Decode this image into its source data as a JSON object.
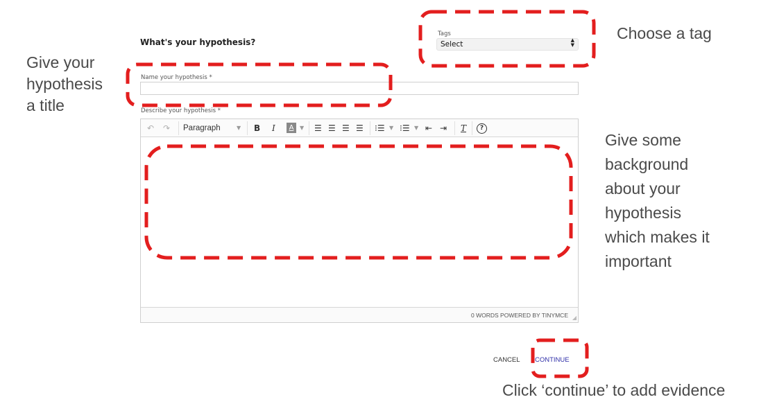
{
  "form": {
    "title": "What's your hypothesis?",
    "tags_label": "Tags",
    "tags_value": "Select",
    "name_label": "Name your hypothesis *",
    "name_value": "",
    "describe_label": "Describe your hypothesis *"
  },
  "editor": {
    "toolbar": {
      "undo_icon": "undo-icon",
      "redo_icon": "redo-icon",
      "format_select": "Paragraph",
      "bold": "B",
      "italic": "I",
      "text_color": "A",
      "icons": [
        "align-left-icon",
        "align-center-icon",
        "align-right-icon",
        "align-justify-icon",
        "bullet-list-icon",
        "numbered-list-icon",
        "outdent-icon",
        "indent-icon",
        "clear-format-icon",
        "help-icon"
      ]
    },
    "status": "0 WORDS POWERED BY TINYMCE"
  },
  "actions": {
    "cancel": "CANCEL",
    "continue": "CONTINUE"
  },
  "annotations": {
    "title_hint": [
      "Give your",
      "hypothesis",
      "a title"
    ],
    "tag_hint": "Choose a tag",
    "background_hint": [
      "Give some",
      "background",
      "about your",
      "hypothesis",
      "which makes it",
      "important"
    ],
    "continue_hint": "Click ‘continue’ to add evidence"
  },
  "colors": {
    "annotation_dash": "#e31e1e",
    "continue_link": "#2f2fa8"
  }
}
